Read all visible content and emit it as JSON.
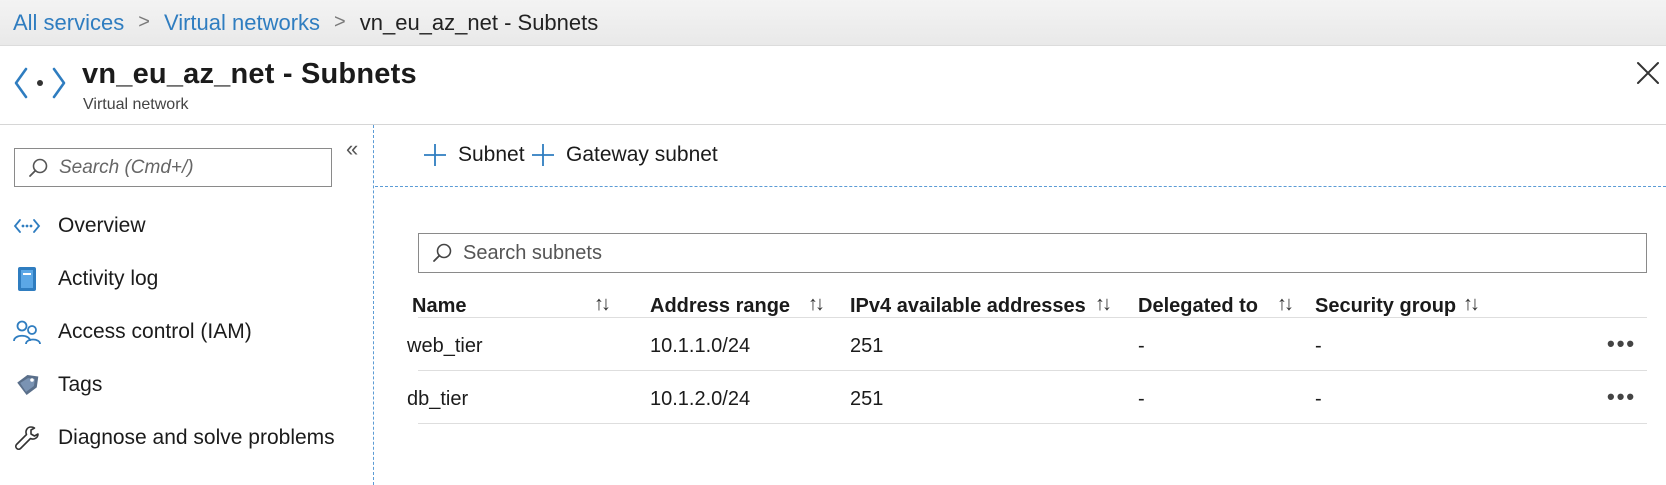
{
  "breadcrumb": {
    "items": [
      {
        "label": "All services"
      },
      {
        "label": "Virtual networks"
      }
    ],
    "current": "vn_eu_az_net - Subnets"
  },
  "header": {
    "title": "vn_eu_az_net - Subnets",
    "subtitle": "Virtual network",
    "icon": "virtual-network-icon"
  },
  "sidebar": {
    "search_placeholder": "Search (Cmd+/)",
    "items": [
      {
        "label": "Overview",
        "icon": "overview-icon"
      },
      {
        "label": "Activity log",
        "icon": "activity-log-icon"
      },
      {
        "label": "Access control (IAM)",
        "icon": "access-control-icon"
      },
      {
        "label": "Tags",
        "icon": "tag-icon"
      },
      {
        "label": "Diagnose and solve problems",
        "icon": "wrench-icon"
      }
    ]
  },
  "toolbar": {
    "add_subnet_label": "Subnet",
    "add_gateway_subnet_label": "Gateway subnet"
  },
  "table": {
    "search_placeholder": "Search subnets",
    "columns": [
      "Name",
      "Address range",
      "IPv4 available addresses",
      "Delegated to",
      "Security group"
    ],
    "rows": [
      {
        "name": "web_tier",
        "address_range": "10.1.1.0/24",
        "ipv4_available": "251",
        "delegated_to": "-",
        "security_group": "-"
      },
      {
        "name": "db_tier",
        "address_range": "10.1.2.0/24",
        "ipv4_available": "251",
        "delegated_to": "-",
        "security_group": "-"
      }
    ],
    "more_label": "•••",
    "sort_glyph": "↑↓"
  },
  "colors": {
    "accent": "#2f7dc0",
    "divider": "#5b9bd5"
  }
}
